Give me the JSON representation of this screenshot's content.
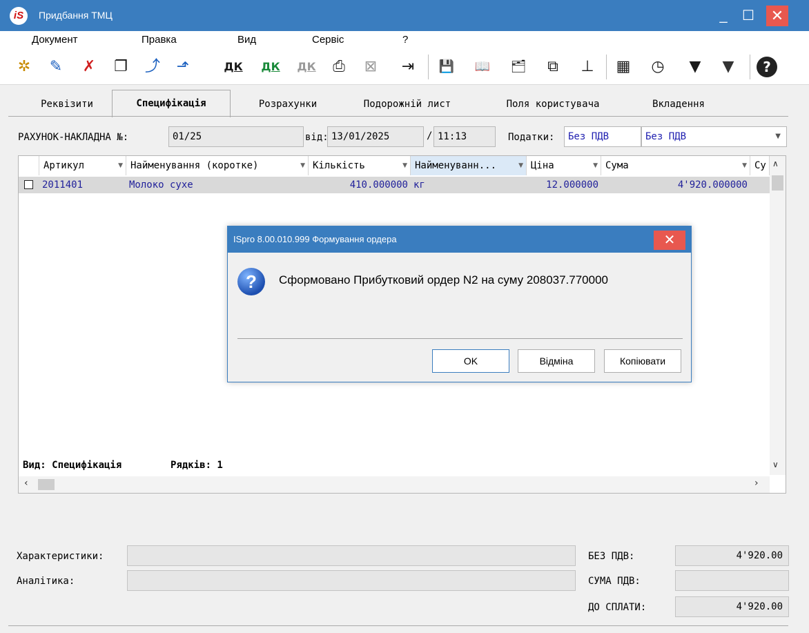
{
  "window": {
    "title": "Придбання ТМЦ",
    "logo_text": "iS",
    "min_glyph": "_",
    "max_glyph": "☐",
    "close_glyph": "✕"
  },
  "menu": [
    "Документ",
    "Правка",
    "Вид",
    "Сервіс",
    "?"
  ],
  "toolbar": [
    {
      "name": "new-doc-icon",
      "glyph": "✲"
    },
    {
      "name": "edit-doc-icon",
      "glyph": "✎"
    },
    {
      "name": "delete-doc-icon",
      "glyph": "✗"
    },
    {
      "name": "copy-doc-icon",
      "glyph": "❐"
    },
    {
      "name": "doc-up-icon",
      "glyph": "⤴"
    },
    {
      "name": "doc-forward-icon",
      "glyph": "⬏"
    },
    {
      "name": "debit-credit-icon",
      "glyph": "ДК"
    },
    {
      "name": "debit-credit-green-icon",
      "glyph": "ДК"
    },
    {
      "name": "debit-credit-disabled-icon",
      "glyph": "ДК"
    },
    {
      "name": "print-icon",
      "glyph": "⎙"
    },
    {
      "name": "cancel-doc-icon",
      "glyph": "⊠"
    },
    {
      "name": "exit-door-icon",
      "glyph": "⇥"
    },
    {
      "name": "save-icon",
      "glyph": "💾"
    },
    {
      "name": "book-icon",
      "glyph": "📖"
    },
    {
      "name": "folder-search-icon",
      "glyph": "🗂"
    },
    {
      "name": "link-icon",
      "glyph": "⧉"
    },
    {
      "name": "hierarchy-icon",
      "glyph": "⊥"
    },
    {
      "name": "table-icon",
      "glyph": "▦"
    },
    {
      "name": "history-icon",
      "glyph": "◷"
    },
    {
      "name": "filter-icon",
      "glyph": "▼"
    },
    {
      "name": "filter-clear-icon",
      "glyph": "▼"
    },
    {
      "name": "help-icon",
      "glyph": "?"
    }
  ],
  "tabs": [
    "Реквізити",
    "Специфікація",
    "Розрахунки",
    "Подорожній лист",
    "Поля користувача",
    "Вкладення"
  ],
  "header": {
    "invoice_label": "РАХУНОК-НАКЛАДНА №:",
    "invoice_no": "01/25",
    "date_label": "від:",
    "date": "13/01/2025",
    "time_sep": "/",
    "time": "11:13",
    "tax_label": "Податки:",
    "tax1": "Без ПДВ",
    "tax2": "Без ПДВ"
  },
  "grid": {
    "columns": [
      "Артикул",
      "Найменування (коротке)",
      "Кількість",
      "Найменуванн...",
      "Ціна",
      "Сума",
      "Су"
    ],
    "rows": [
      {
        "article": "2011401",
        "name": "Молоко сухе",
        "qty": "410.000000",
        "unit": "кг",
        "price": "12.000000",
        "sum": "4'920.000000"
      }
    ],
    "footer_view": "Вид: Специфікація",
    "footer_rows": "Рядків: 1"
  },
  "dialog": {
    "title": "ISpro 8.00.010.999 Формування ордера",
    "message": "Сформовано Прибутковий ордер N2 на суму 208037.770000",
    "buttons": {
      "ok": "OK",
      "cancel": "Відміна",
      "copy": "Копіювати"
    }
  },
  "footer": {
    "characteristics_label": "Характеристики:",
    "analytics_label": "Аналітика:",
    "no_vat_label": "БЕЗ ПДВ:",
    "no_vat_value": "4'920.00",
    "vat_sum_label": "СУМА ПДВ:",
    "vat_sum_value": "",
    "to_pay_label": "ДО СПЛАТИ:",
    "to_pay_value": "4'920.00"
  },
  "colors": {
    "titlebar": "#3a7dbf",
    "close": "#e8584f",
    "link_text": "#1f1f9a"
  }
}
